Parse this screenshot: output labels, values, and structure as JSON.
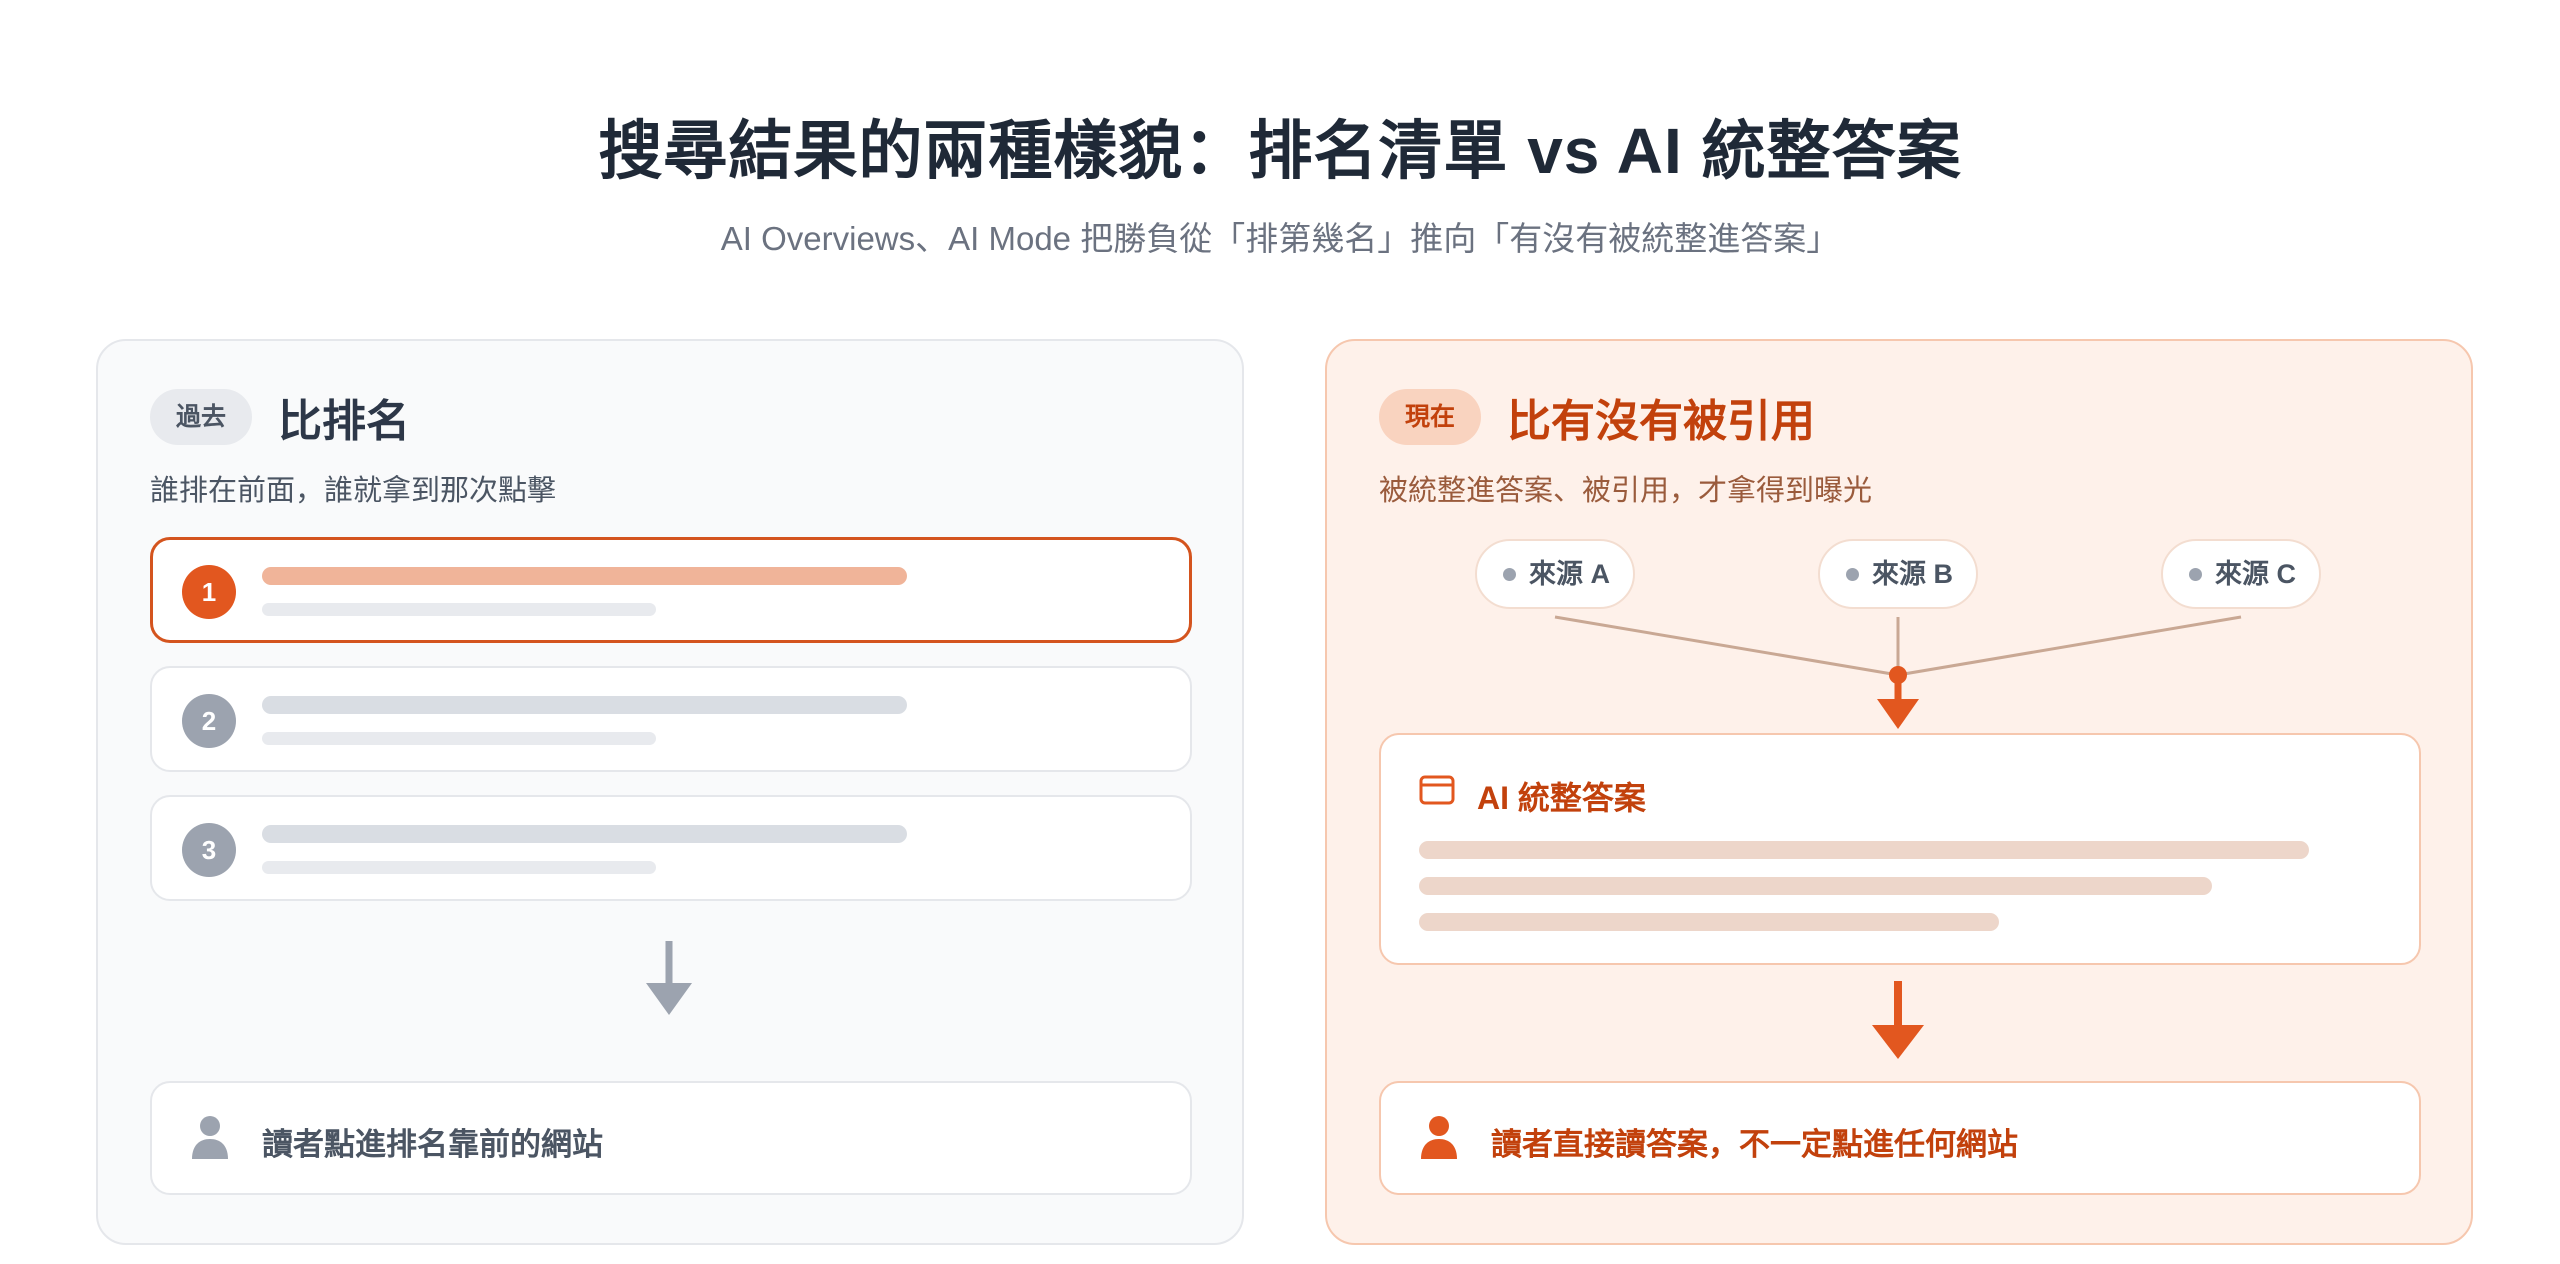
{
  "header": {
    "title": "搜尋結果的兩種樣貌：排名清單 vs AI 統整答案",
    "subtitle": "AI Overviews、AI Mode 把勝負從「排第幾名」推向「有沒有被統整進答案」"
  },
  "left_panel": {
    "tag": "過去",
    "title": "比排名",
    "description": "誰排在前面，誰就拿到那次點擊",
    "ranks": [
      "1",
      "2",
      "3"
    ],
    "result_icon": "person-icon",
    "result_text": "讀者點進排名靠前的網站"
  },
  "right_panel": {
    "tag": "現在",
    "title": "比有沒有被引用",
    "description": "被統整進答案、被引用，才拿得到曝光",
    "sources": [
      "來源 A",
      "來源 B",
      "來源 C"
    ],
    "answer_icon": "browser-window-icon",
    "answer_title": "AI 統整答案",
    "result_icon": "person-icon",
    "result_text": "讀者直接讀答案，不一定點進任何網站"
  },
  "colors": {
    "accent": "#e2571f",
    "accent_dark": "#c2410c",
    "neutral": "#9ca3af",
    "title": "#1f2937"
  }
}
